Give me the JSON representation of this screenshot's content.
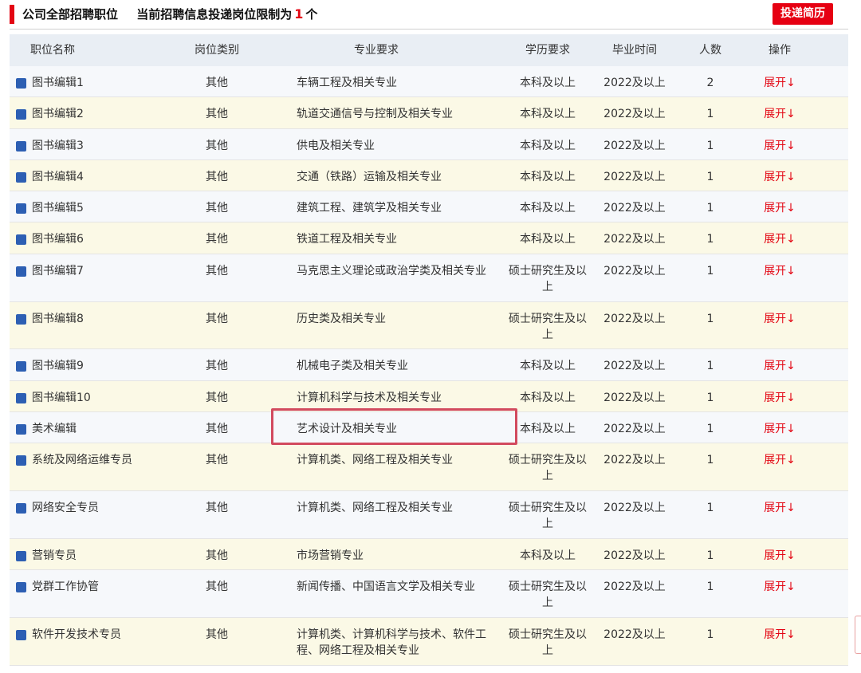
{
  "header": {
    "title": "公司全部招聘职位",
    "notice_prefix": "当前招聘信息投递岗位限制为",
    "limit": "1",
    "notice_suffix": "个",
    "submit_label": "投递简历"
  },
  "table": {
    "columns": [
      "职位名称",
      "岗位类别",
      "专业要求",
      "学历要求",
      "毕业时间",
      "人数",
      "操作"
    ],
    "rows": [
      {
        "name": "图书编辑1",
        "type": "其他",
        "major": "车辆工程及相关专业",
        "edu": "本科及以上",
        "grad": "2022及以上",
        "num": "2",
        "op": "展开",
        "arrow": "↓"
      },
      {
        "name": "图书编辑2",
        "type": "其他",
        "major": "轨道交通信号与控制及相关专业",
        "edu": "本科及以上",
        "grad": "2022及以上",
        "num": "1",
        "op": "展开",
        "arrow": "↓"
      },
      {
        "name": "图书编辑3",
        "type": "其他",
        "major": "供电及相关专业",
        "edu": "本科及以上",
        "grad": "2022及以上",
        "num": "1",
        "op": "展开",
        "arrow": "↓"
      },
      {
        "name": "图书编辑4",
        "type": "其他",
        "major": "交通（铁路）运输及相关专业",
        "edu": "本科及以上",
        "grad": "2022及以上",
        "num": "1",
        "op": "展开",
        "arrow": "↓"
      },
      {
        "name": "图书编辑5",
        "type": "其他",
        "major": "建筑工程、建筑学及相关专业",
        "edu": "本科及以上",
        "grad": "2022及以上",
        "num": "1",
        "op": "展开",
        "arrow": "↓"
      },
      {
        "name": "图书编辑6",
        "type": "其他",
        "major": "铁道工程及相关专业",
        "edu": "本科及以上",
        "grad": "2022及以上",
        "num": "1",
        "op": "展开",
        "arrow": "↓"
      },
      {
        "name": "图书编辑7",
        "type": "其他",
        "major": "马克思主义理论或政治学类及相关专业",
        "edu": "硕士研究生及以上",
        "grad": "2022及以上",
        "num": "1",
        "op": "展开",
        "arrow": "↓"
      },
      {
        "name": "图书编辑8",
        "type": "其他",
        "major": "历史类及相关专业",
        "edu": "硕士研究生及以上",
        "grad": "2022及以上",
        "num": "1",
        "op": "展开",
        "arrow": "↓"
      },
      {
        "name": "图书编辑9",
        "type": "其他",
        "major": "机械电子类及相关专业",
        "edu": "本科及以上",
        "grad": "2022及以上",
        "num": "1",
        "op": "展开",
        "arrow": "↓"
      },
      {
        "name": "图书编辑10",
        "type": "其他",
        "major": "计算机科学与技术及相关专业",
        "edu": "本科及以上",
        "grad": "2022及以上",
        "num": "1",
        "op": "展开",
        "arrow": "↓"
      },
      {
        "name": "美术编辑",
        "type": "其他",
        "major": "艺术设计及相关专业",
        "edu": "本科及以上",
        "grad": "2022及以上",
        "num": "1",
        "op": "展开",
        "arrow": "↓"
      },
      {
        "name": "系统及网络运维专员",
        "type": "其他",
        "major": "计算机类、网络工程及相关专业",
        "edu": "硕士研究生及以上",
        "grad": "2022及以上",
        "num": "1",
        "op": "展开",
        "arrow": "↓"
      },
      {
        "name": "网络安全专员",
        "type": "其他",
        "major": "计算机类、网络工程及相关专业",
        "edu": "硕士研究生及以上",
        "grad": "2022及以上",
        "num": "1",
        "op": "展开",
        "arrow": "↓"
      },
      {
        "name": "营销专员",
        "type": "其他",
        "major": "市场营销专业",
        "edu": "本科及以上",
        "grad": "2022及以上",
        "num": "1",
        "op": "展开",
        "arrow": "↓"
      },
      {
        "name": "党群工作协管",
        "type": "其他",
        "major": "新闻传播、中国语言文学及相关专业",
        "edu": "硕士研究生及以上",
        "grad": "2022及以上",
        "num": "1",
        "op": "展开",
        "arrow": "↓"
      },
      {
        "name": "软件开发技术专员",
        "type": "其他",
        "major": "计算机类、计算机科学与技术、软件工程、网络工程及相关专业",
        "edu": "硕士研究生及以上",
        "grad": "2022及以上",
        "num": "1",
        "op": "展开",
        "arrow": "↓"
      }
    ]
  },
  "colors": {
    "accent": "#e30613",
    "checkbox": "#2d5fb3",
    "header_bg": "#e9eef4",
    "row_odd": "#f6f8fb",
    "row_even": "#fbf9e6",
    "highlight": "#d24a5e"
  }
}
